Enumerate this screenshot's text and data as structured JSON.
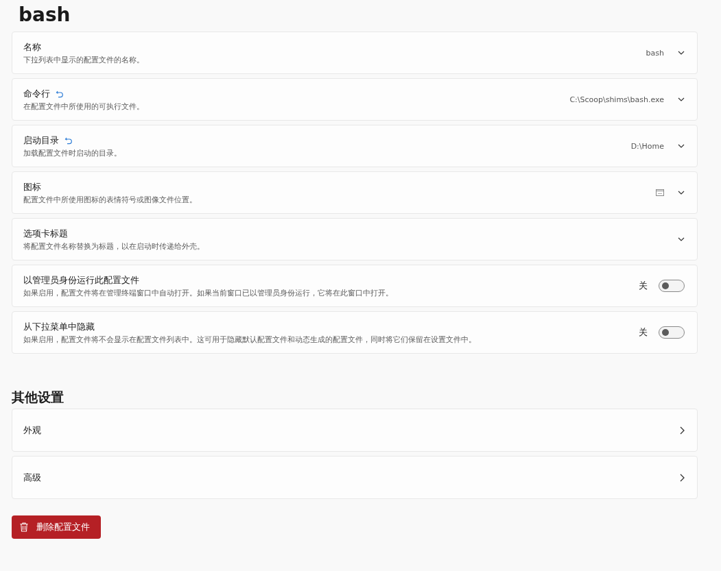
{
  "title": "bash",
  "settings": [
    {
      "kind": "expander",
      "label": "名称",
      "description": "下拉列表中显示的配置文件的名称。",
      "value": "bash",
      "modified": false
    },
    {
      "kind": "expander",
      "label": "命令行",
      "description": "在配置文件中所使用的可执行文件。",
      "value": "C:\\Scoop\\shims\\bash.exe",
      "modified": true
    },
    {
      "kind": "expander",
      "label": "启动目录",
      "description": "加载配置文件时启动的目录。",
      "value": "D:\\Home",
      "modified": true
    },
    {
      "kind": "expander-icon",
      "label": "图标",
      "description": "配置文件中所使用图标的表情符号或图像文件位置。",
      "modified": false
    },
    {
      "kind": "expander",
      "label": "选项卡标题",
      "description": "将配置文件名称替换为标题，以在启动时传递给外壳。",
      "modified": false
    },
    {
      "kind": "toggle",
      "label": "以管理员身份运行此配置文件",
      "description": "如果启用，配置文件将在管理终端窗口中自动打开。如果当前窗口已以管理员身份运行，它将在此窗口中打开。",
      "state_label": "关",
      "on": false
    },
    {
      "kind": "toggle",
      "label": "从下拉菜单中隐藏",
      "description": "如果启用，配置文件将不会显示在配置文件列表中。这可用于隐藏默认配置文件和动态生成的配置文件，同时将它们保留在设置文件中。",
      "state_label": "关",
      "on": false
    }
  ],
  "other_settings": {
    "heading": "其他设置",
    "items": [
      "外观",
      "高级"
    ]
  },
  "delete_button": "删除配置文件"
}
